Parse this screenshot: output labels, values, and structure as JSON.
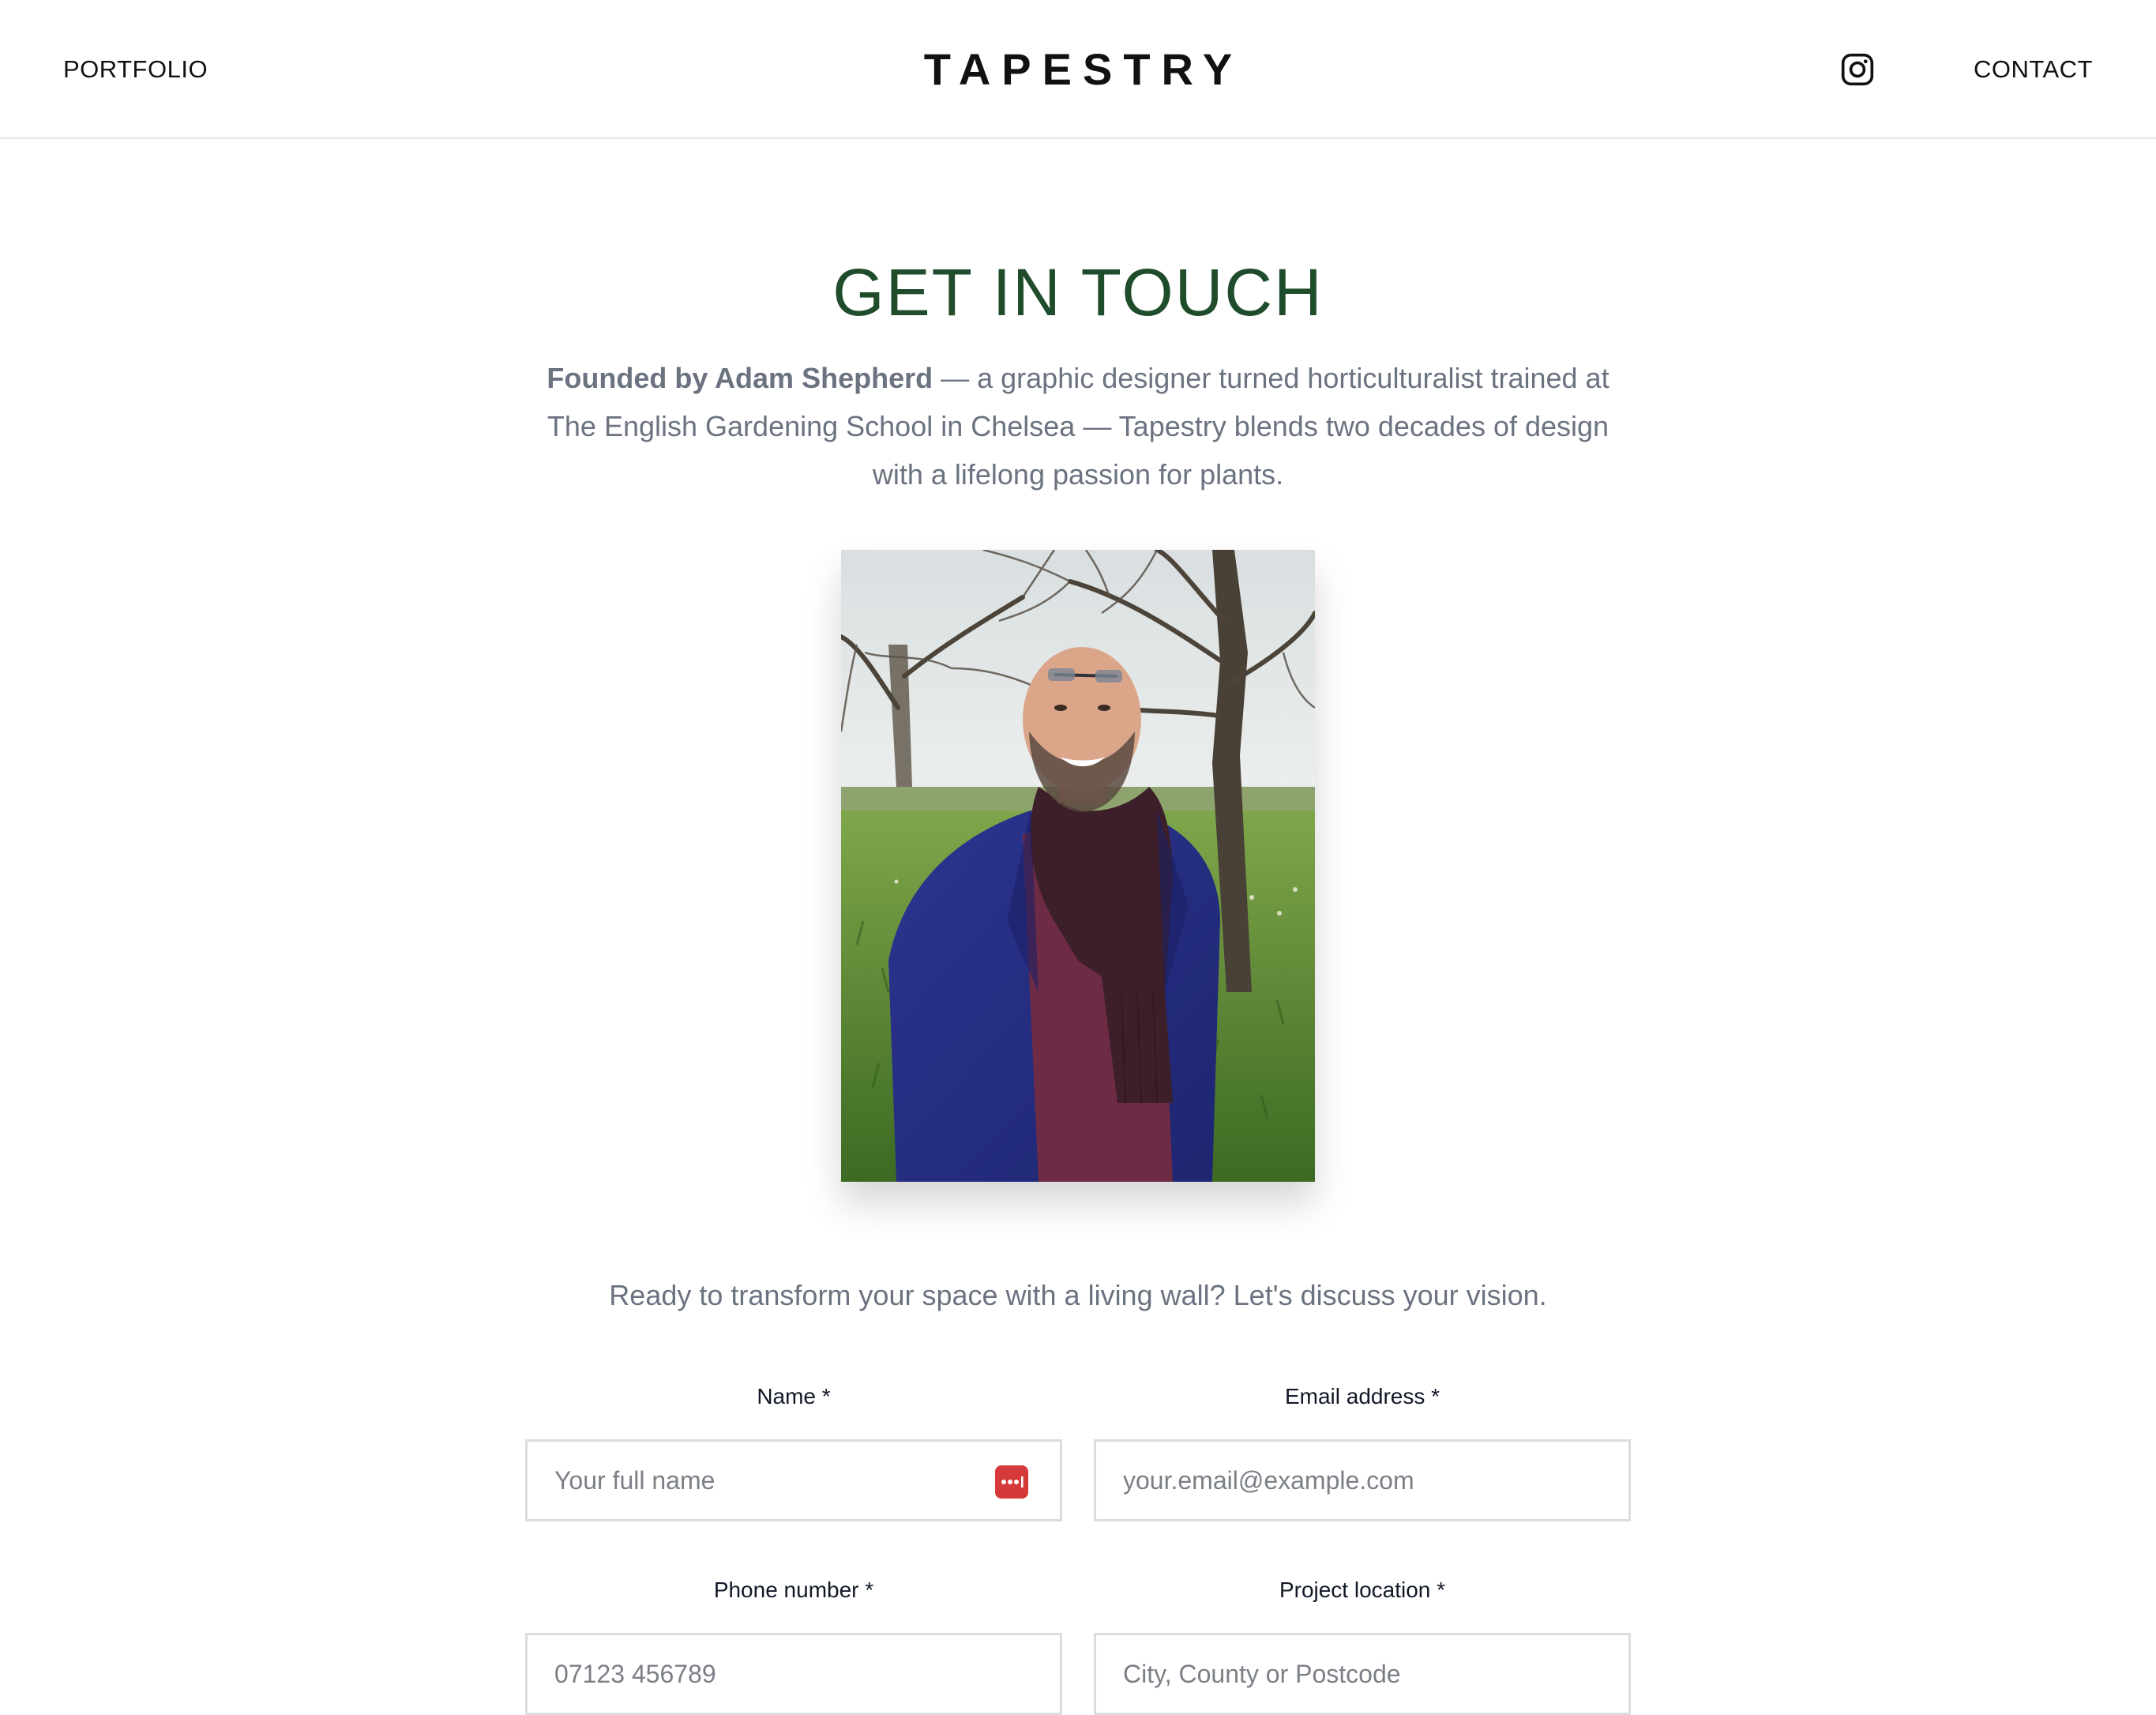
{
  "header": {
    "nav_left": "PORTFOLIO",
    "logo": "TAPESTRY",
    "instagram_icon": "instagram-icon",
    "nav_right": "CONTACT"
  },
  "main": {
    "title": "GET IN TOUCH",
    "intro_bold": "Founded by Adam Shepherd",
    "intro_rest": " — a graphic designer turned horticulturalist trained at The English Gardening School in Chelsea — Tapestry blends two decades of design with a lifelong passion for plants.",
    "photo": "portrait-photo",
    "tagline": "Ready to transform your space with a living wall? Let's discuss your vision."
  },
  "form": {
    "name": {
      "label": "Name *",
      "placeholder": "Your full name"
    },
    "email": {
      "label": "Email address *",
      "placeholder": "your.email@example.com"
    },
    "phone": {
      "label": "Phone number *",
      "placeholder": "07123 456789"
    },
    "location": {
      "label": "Project location *",
      "placeholder": "City, County or Postcode"
    },
    "autofill_icon": "password-manager-icon"
  },
  "colors": {
    "accent_green": "#1f4d2c",
    "body_text": "#6b7280",
    "autofill_red": "#d6393a"
  }
}
